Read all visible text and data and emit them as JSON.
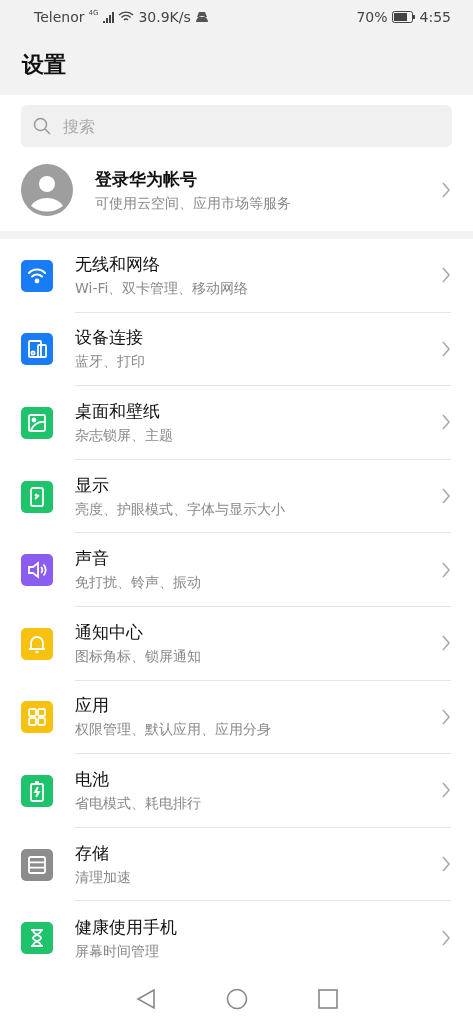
{
  "status_bar": {
    "carrier": "Telenor",
    "network": "4G",
    "speed": "30.9K/s",
    "battery": "70%",
    "time": "4:55"
  },
  "header": {
    "title": "设置"
  },
  "search": {
    "placeholder": "搜索"
  },
  "account": {
    "title": "登录华为帐号",
    "subtitle": "可使用云空间、应用市场等服务"
  },
  "items": [
    {
      "kind": "wifi",
      "color": "#1a7cf5",
      "title": "无线和网络",
      "subtitle": "Wi-Fi、双卡管理、移动网络"
    },
    {
      "kind": "devices",
      "color": "#1a7cf5",
      "title": "设备连接",
      "subtitle": "蓝牙、打印"
    },
    {
      "kind": "wallpaper",
      "color": "#1fc36b",
      "title": "桌面和壁纸",
      "subtitle": "杂志锁屏、主题"
    },
    {
      "kind": "display",
      "color": "#1fc36b",
      "title": "显示",
      "subtitle": "亮度、护眼模式、字体与显示大小"
    },
    {
      "kind": "sound",
      "color": "#8a5cf0",
      "title": "声音",
      "subtitle": "免打扰、铃声、振动"
    },
    {
      "kind": "bell",
      "color": "#f7c20f",
      "title": "通知中心",
      "subtitle": "图标角标、锁屏通知"
    },
    {
      "kind": "apps",
      "color": "#f7c20f",
      "title": "应用",
      "subtitle": "权限管理、默认应用、应用分身"
    },
    {
      "kind": "battery",
      "color": "#1fc36b",
      "title": "电池",
      "subtitle": "省电模式、耗电排行"
    },
    {
      "kind": "storage",
      "color": "#8c8c8c",
      "title": "存储",
      "subtitle": "清理加速"
    },
    {
      "kind": "hourglass",
      "color": "#1fc36b",
      "title": "健康使用手机",
      "subtitle": "屏幕时间管理"
    }
  ]
}
